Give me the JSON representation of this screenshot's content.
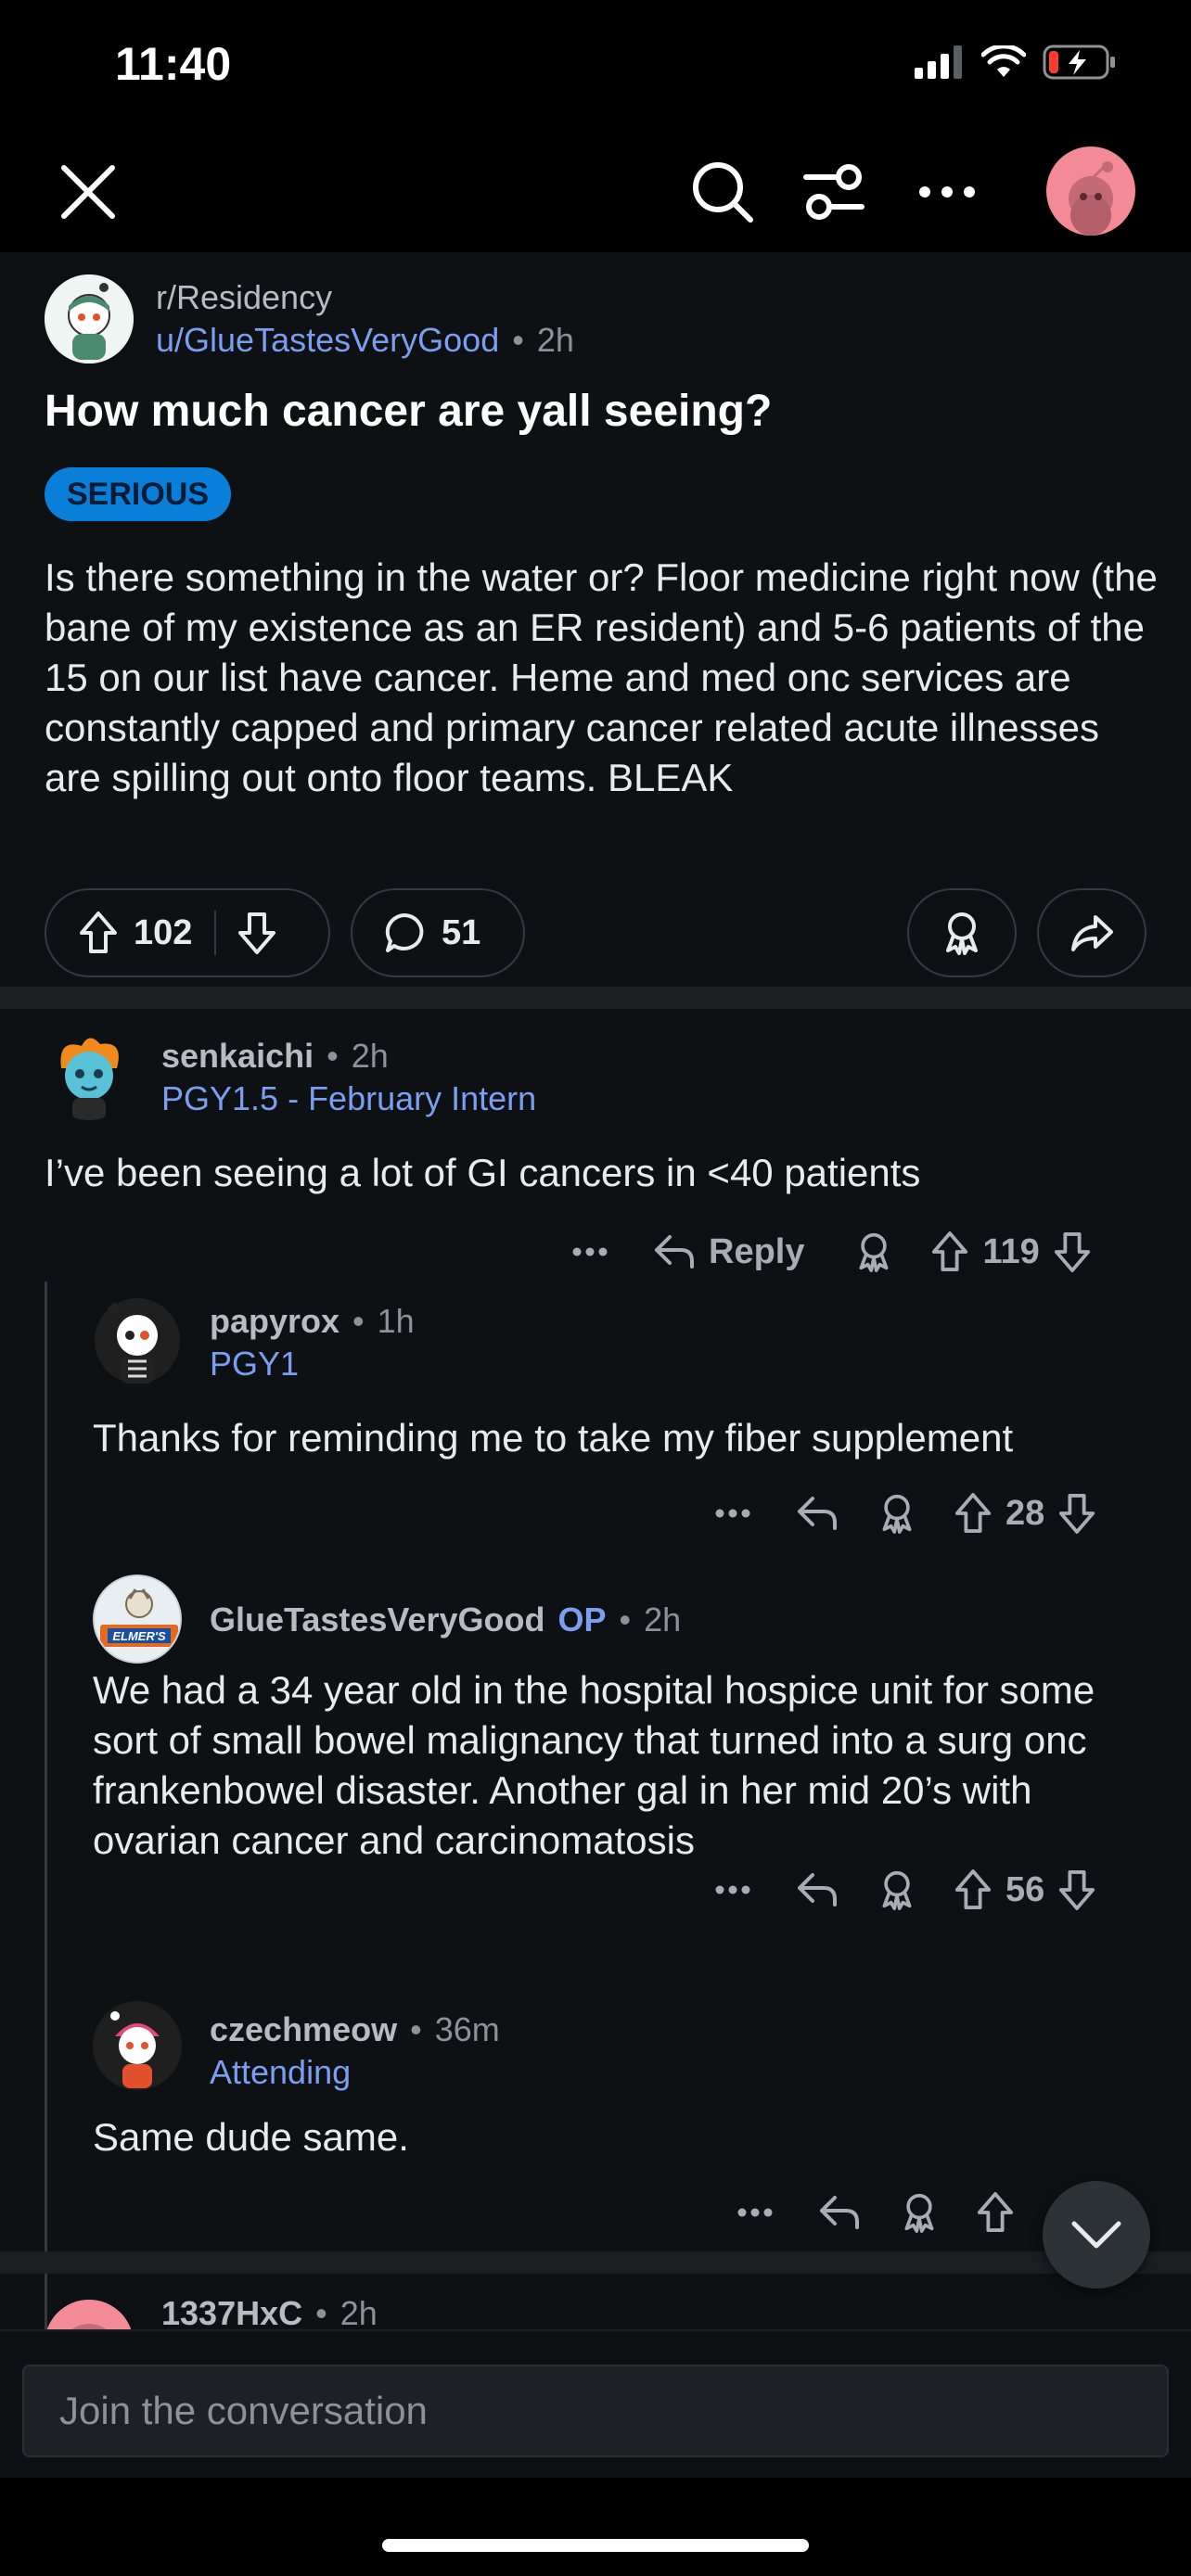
{
  "status": {
    "time": "11:40"
  },
  "post": {
    "subreddit": "r/Residency",
    "author": "u/GlueTastesVeryGood",
    "age": "2h",
    "title": "How much cancer are yall seeing?",
    "flair": "SERIOUS",
    "body": "Is there something in the water or? Floor medicine right now (the bane of my existence as an ER resident) and 5-6 patients of the 15 on our list have cancer. Heme and med onc services are constantly capped and primary cancer related acute illnesses are spilling out onto floor teams. BLEAK",
    "upvotes": "102",
    "comments": "51"
  },
  "comments": [
    {
      "user": "senkaichi",
      "age": "2h",
      "flair": "PGY1.5 - February Intern",
      "text": "I’ve been seeing a lot of GI cancers in <40 patients",
      "reply_label": "Reply",
      "score": "119"
    },
    {
      "user": "papyrox",
      "age": "1h",
      "flair": "PGY1",
      "text": "Thanks for reminding me to take my fiber supplement",
      "score": "28"
    },
    {
      "user": "GlueTastesVeryGood",
      "op_tag": "OP",
      "age": "2h",
      "avatar_text": "ELMER'S",
      "text": "We had a 34 year old in the hospital hospice unit for some sort of small bowel malignancy that turned into a surg onc frankenbowel disaster. Another gal in her mid 20’s with ovarian cancer and carcinomatosis",
      "score": "56"
    },
    {
      "user": "czechmeow",
      "age": "36m",
      "flair": "Attending",
      "text": "Same dude same."
    },
    {
      "user": "1337HxC",
      "age": "2h"
    }
  ],
  "composer": {
    "placeholder": "Join the conversation"
  },
  "icons": [
    "close-icon",
    "search-icon",
    "filter-icon",
    "more-icon",
    "upvote-icon",
    "downvote-icon",
    "comment-icon",
    "award-icon",
    "share-icon",
    "reply-icon",
    "chevron-down-icon"
  ]
}
